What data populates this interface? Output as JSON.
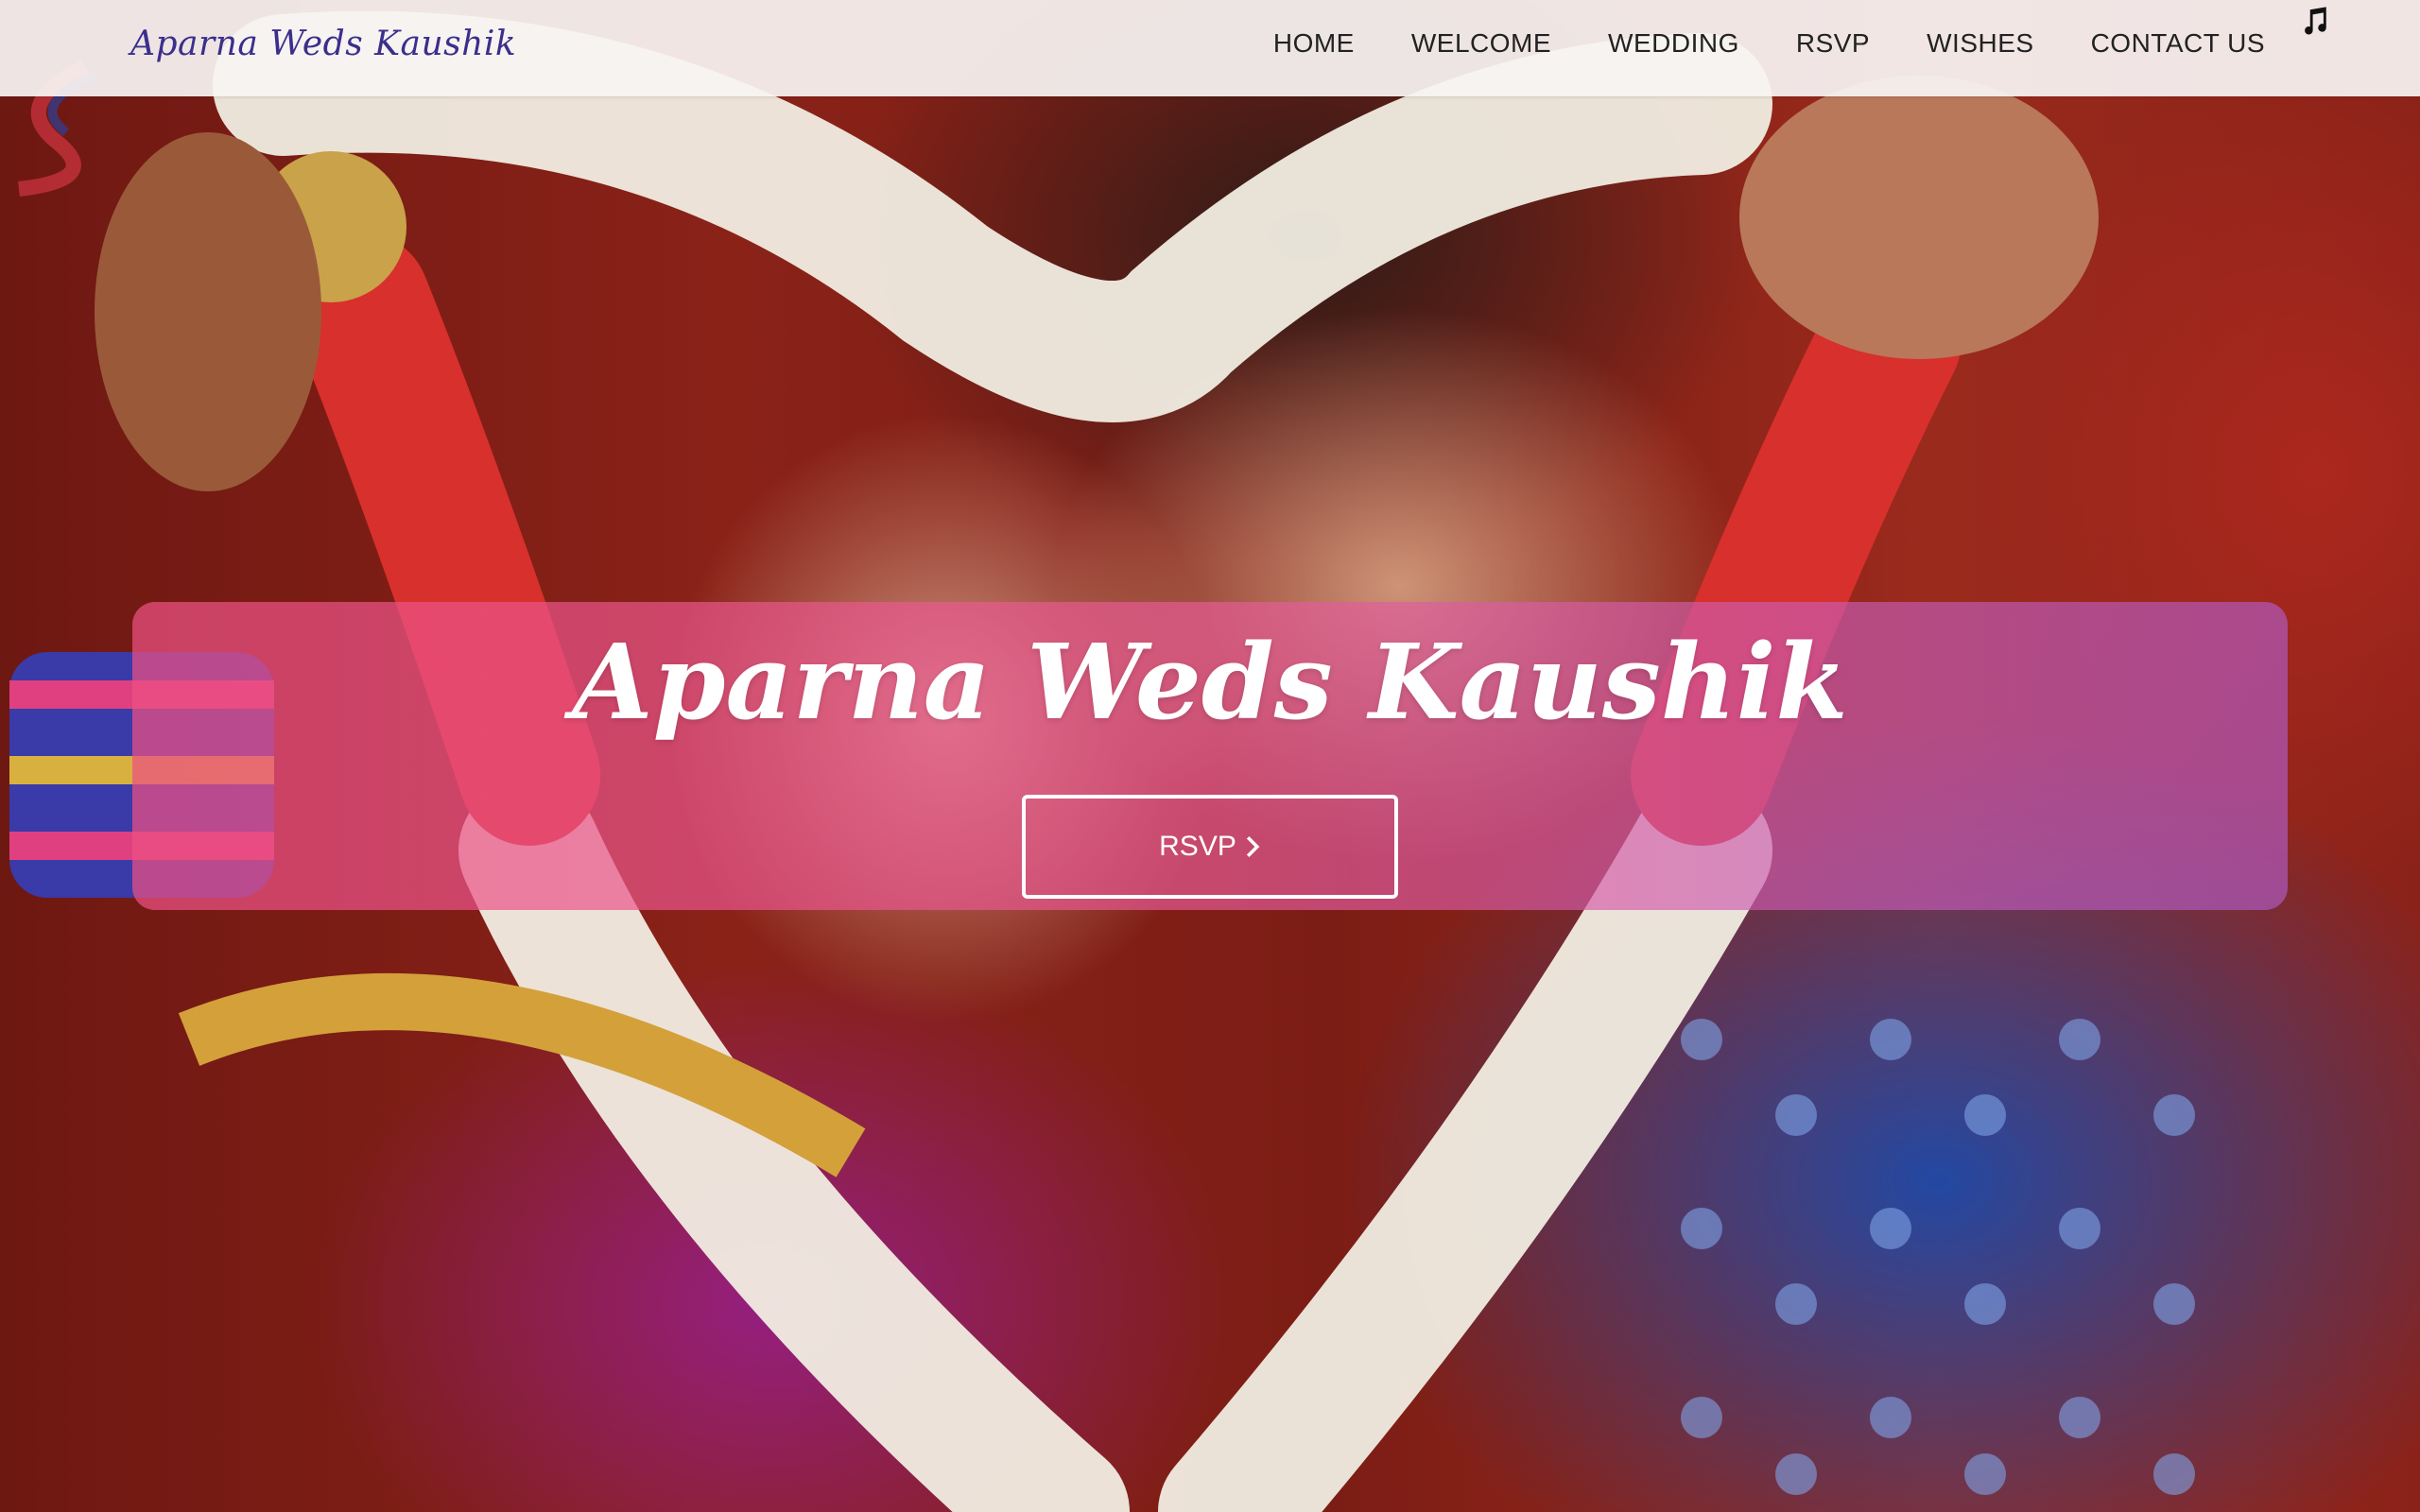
{
  "header": {
    "brand": "Aparna Weds Kaushik",
    "nav": [
      {
        "label": "HOME"
      },
      {
        "label": "WELCOME"
      },
      {
        "label": "WEDDING"
      },
      {
        "label": "RSVP"
      },
      {
        "label": "WISHES"
      },
      {
        "label": "CONTACT US"
      }
    ],
    "music_icon": "music-note-icon"
  },
  "hero": {
    "title": "Aparna Weds Kaushik",
    "button_label": "RSVP",
    "button_icon": "chevron-right-icon"
  },
  "colors": {
    "brand_text": "#3a2f8c",
    "nav_text": "#222222",
    "overlay_pink": "#ec5082",
    "overlay_violet": "#b05cc8"
  }
}
